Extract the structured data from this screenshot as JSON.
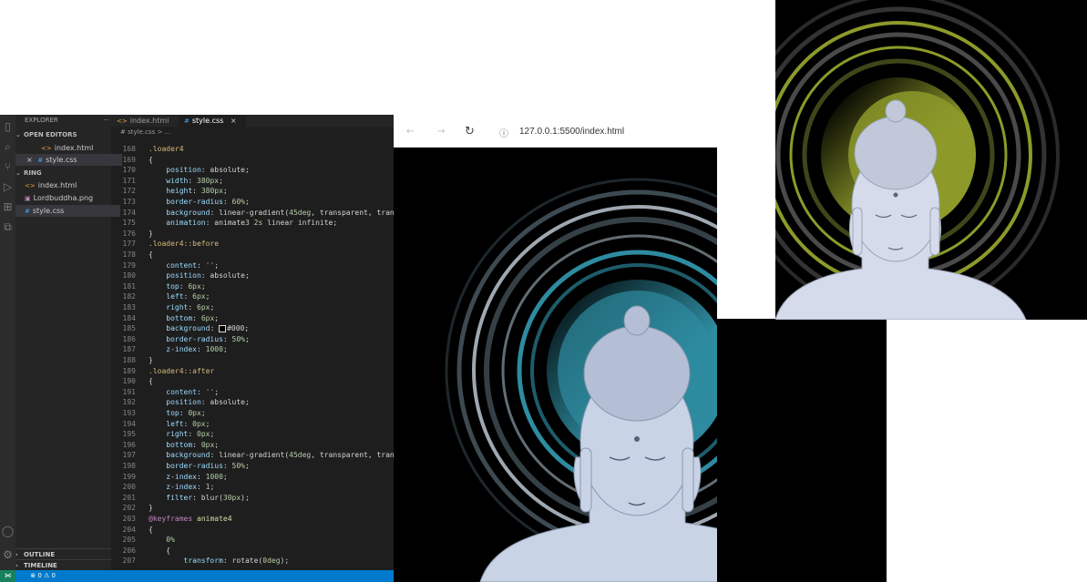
{
  "vscode": {
    "explorer_title": "EXPLORER",
    "open_editors_label": "OPEN EDITORS",
    "open_editors": [
      {
        "name": "index.html",
        "type": "html"
      },
      {
        "name": "style.css",
        "type": "css",
        "modified_marker": "×"
      }
    ],
    "folder_label": "RING",
    "files": [
      {
        "name": "index.html",
        "type": "html"
      },
      {
        "name": "Lordbuddha.png",
        "type": "png"
      },
      {
        "name": "style.css",
        "type": "css"
      }
    ],
    "outline_label": "OUTLINE",
    "timeline_label": "TIMELINE",
    "tabs": [
      {
        "label": "index.html",
        "active": false
      },
      {
        "label": "style.css",
        "active": true,
        "close": "×"
      }
    ],
    "breadcrumb": "# style.css > ...",
    "status": "⊗ 0 ⚠ 0",
    "code_lines": [
      {
        "n": "168",
        "text": ".loader4"
      },
      {
        "n": "169",
        "text": "{"
      },
      {
        "n": "170",
        "text": "    position: absolute;"
      },
      {
        "n": "171",
        "text": "    width: 380px;"
      },
      {
        "n": "172",
        "text": "    height: 380px;"
      },
      {
        "n": "173",
        "text": "    border-radius: 60%;"
      },
      {
        "n": "174",
        "text": "    background: linear-gradient(45deg, transparent, tran"
      },
      {
        "n": "175",
        "text": "    animation: animate3 2s linear infinite;"
      },
      {
        "n": "176",
        "text": "}"
      },
      {
        "n": "177",
        "text": ".loader4::before"
      },
      {
        "n": "178",
        "text": "{"
      },
      {
        "n": "179",
        "text": "    content: '';"
      },
      {
        "n": "180",
        "text": "    position: absolute;"
      },
      {
        "n": "181",
        "text": "    top: 6px;"
      },
      {
        "n": "182",
        "text": "    left: 6px;"
      },
      {
        "n": "183",
        "text": "    right: 6px;"
      },
      {
        "n": "184",
        "text": "    bottom: 6px;"
      },
      {
        "n": "185",
        "text": "    background: #000;"
      },
      {
        "n": "186",
        "text": "    border-radius: 50%;"
      },
      {
        "n": "187",
        "text": "    z-index: 1000;"
      },
      {
        "n": "188",
        "text": "}"
      },
      {
        "n": "189",
        "text": ".loader4::after"
      },
      {
        "n": "190",
        "text": "{"
      },
      {
        "n": "191",
        "text": "    content: '';"
      },
      {
        "n": "192",
        "text": "    position: absolute;"
      },
      {
        "n": "193",
        "text": "    top: 0px;"
      },
      {
        "n": "194",
        "text": "    left: 0px;"
      },
      {
        "n": "195",
        "text": "    right: 0px;"
      },
      {
        "n": "196",
        "text": "    bottom: 0px;"
      },
      {
        "n": "197",
        "text": "    background: linear-gradient(45deg, transparent, tran"
      },
      {
        "n": "198",
        "text": "    border-radius: 50%;"
      },
      {
        "n": "199",
        "text": "    z-index: 1000;"
      },
      {
        "n": "200",
        "text": "    z-index: 1;"
      },
      {
        "n": "201",
        "text": "    filter: blur(30px);"
      },
      {
        "n": "202",
        "text": "}"
      },
      {
        "n": "203",
        "text": "@keyframes animate4"
      },
      {
        "n": "204",
        "text": "{"
      },
      {
        "n": "205",
        "text": "    0%"
      },
      {
        "n": "206",
        "text": "    {"
      },
      {
        "n": "207",
        "text": "        transform: rotate(0deg);"
      }
    ]
  },
  "browser": {
    "url": "127.0.0.1:5500/index.html",
    "ring_color": "#2e8ba0"
  },
  "preview": {
    "ring_color": "#8d9a2a"
  }
}
